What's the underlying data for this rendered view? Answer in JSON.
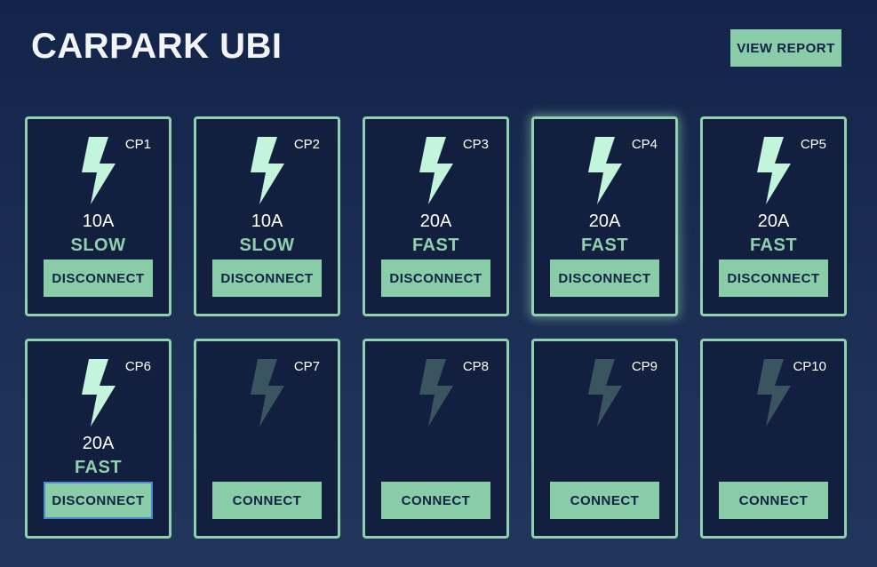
{
  "app": {
    "title": "CARPARK UBI",
    "report_label": "VIEW REPORT"
  },
  "colors": {
    "accent": "#8fd0ae",
    "bolt_active": "#c2f5dc",
    "bolt_inactive": "#3b5560",
    "background": "#15264b",
    "card_background": "#131f3f"
  },
  "chargers": [
    {
      "label": "CP1",
      "amps": "10A",
      "speed": "SLOW",
      "action": "DISCONNECT",
      "icon": "lightning-bolt-icon",
      "active": true
    },
    {
      "label": "CP2",
      "amps": "10A",
      "speed": "SLOW",
      "action": "DISCONNECT",
      "icon": "lightning-bolt-icon",
      "active": true
    },
    {
      "label": "CP3",
      "amps": "20A",
      "speed": "FAST",
      "action": "DISCONNECT",
      "icon": "lightning-bolt-icon",
      "active": true
    },
    {
      "label": "CP4",
      "amps": "20A",
      "speed": "FAST",
      "action": "DISCONNECT",
      "icon": "lightning-bolt-icon",
      "active": true
    },
    {
      "label": "CP5",
      "amps": "20A",
      "speed": "FAST",
      "action": "DISCONNECT",
      "icon": "lightning-bolt-icon",
      "active": true
    },
    {
      "label": "CP6",
      "amps": "20A",
      "speed": "FAST",
      "action": "DISCONNECT",
      "icon": "lightning-bolt-icon",
      "active": true
    },
    {
      "label": "CP7",
      "amps": "",
      "speed": "",
      "action": "CONNECT",
      "icon": "lightning-bolt-icon",
      "active": false
    },
    {
      "label": "CP8",
      "amps": "",
      "speed": "",
      "action": "CONNECT",
      "icon": "lightning-bolt-icon",
      "active": false
    },
    {
      "label": "CP9",
      "amps": "",
      "speed": "",
      "action": "CONNECT",
      "icon": "lightning-bolt-icon",
      "active": false
    },
    {
      "label": "CP10",
      "amps": "",
      "speed": "",
      "action": "CONNECT",
      "icon": "lightning-bolt-icon",
      "active": false
    }
  ]
}
